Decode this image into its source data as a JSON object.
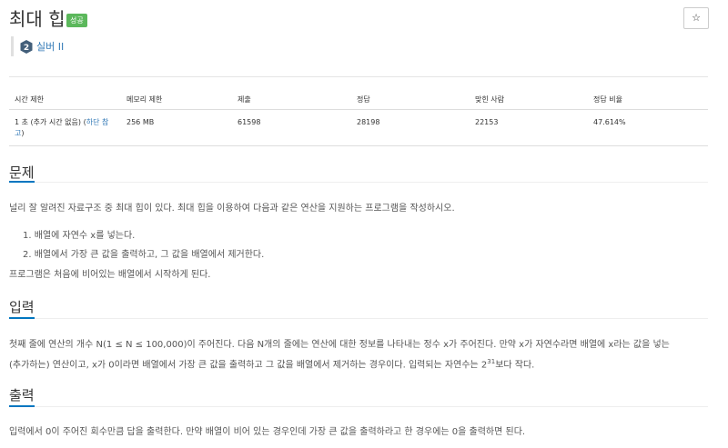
{
  "problem": {
    "title": "최대 힙",
    "badge": "성공",
    "star_icon": "☆",
    "tier": {
      "label": "실버 II",
      "icon": "silver-2-tier-icon",
      "icon_digit": "2"
    }
  },
  "stats": {
    "headers": [
      "시간 제한",
      "메모리 제한",
      "제출",
      "정답",
      "맞힌 사람",
      "정답 비율"
    ],
    "time_limit": "1 초 (추가 시간 없음)",
    "time_limit_link_open": "(",
    "time_limit_link_1": "하단 참",
    "time_limit_link_2": "고",
    "time_limit_link_close": ")",
    "memory_limit": "256 MB",
    "submissions": "61598",
    "accepted": "28198",
    "solvers": "22153",
    "ratio": "47.614%"
  },
  "sections": {
    "problem": {
      "title": "문제",
      "intro": "널리 잘 알려진 자료구조 중 최대 힙이 있다. 최대 힙을 이용하여 다음과 같은 연산을 지원하는 프로그램을 작성하시오.",
      "items": [
        "1. 배열에 자연수 x를 넣는다.",
        "2. 배열에서 가장 큰 값을 출력하고, 그 값을 배열에서 제거한다."
      ],
      "outro": "프로그램은 처음에 비어있는 배열에서 시작하게 된다."
    },
    "input": {
      "title": "입력",
      "line1": "첫째 줄에 연산의 개수 N(1 ≤ N ≤ 100,000)이 주어진다. 다음 N개의 줄에는 연산에 대한 정보를 나타내는 정수 x가 주어진다. 만약 x가 자연수라면 배열에 x라는 값을 넣는",
      "line2_pre": "(추가하는) 연산이고, x가 0이라면 배열에서 가장 큰 값을 출력하고 그 값을 배열에서 제거하는 경우이다. 입력되는 자연수는 2",
      "line2_sup": "31",
      "line2_post": "보다 작다."
    },
    "output": {
      "title": "출력",
      "text": "입력에서 0이 주어진 회수만큼 답을 출력한다. 만약 배열이 비어 있는 경우인데 가장 큰 값을 출력하라고 한 경우에는 0을 출력하면 된다."
    }
  }
}
